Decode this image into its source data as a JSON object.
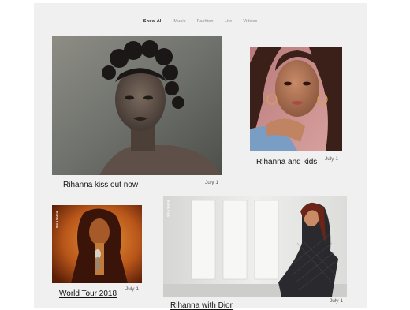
{
  "nav": {
    "items": [
      "Show All",
      "Music",
      "Fashion",
      "Life",
      "Videos"
    ],
    "active": "Show All"
  },
  "posts": [
    {
      "caption": "Rihanna kiss out now",
      "date": "July 1",
      "photo": "bw portrait with hair buns"
    },
    {
      "caption": "Rihanna and kids",
      "date": "July 1",
      "photo": "close-up portrait with hoop earrings"
    },
    {
      "caption": "World Tour 2018",
      "date": "July 1",
      "photo": "orange-toned concert photo"
    },
    {
      "caption": "Rihanna with Dior",
      "date": "July 1",
      "photo": "fashion photo in white room"
    }
  ],
  "colors": {
    "panel": "#f0f0f0",
    "active_nav": "#222222",
    "nav": "#8a8a8a"
  }
}
